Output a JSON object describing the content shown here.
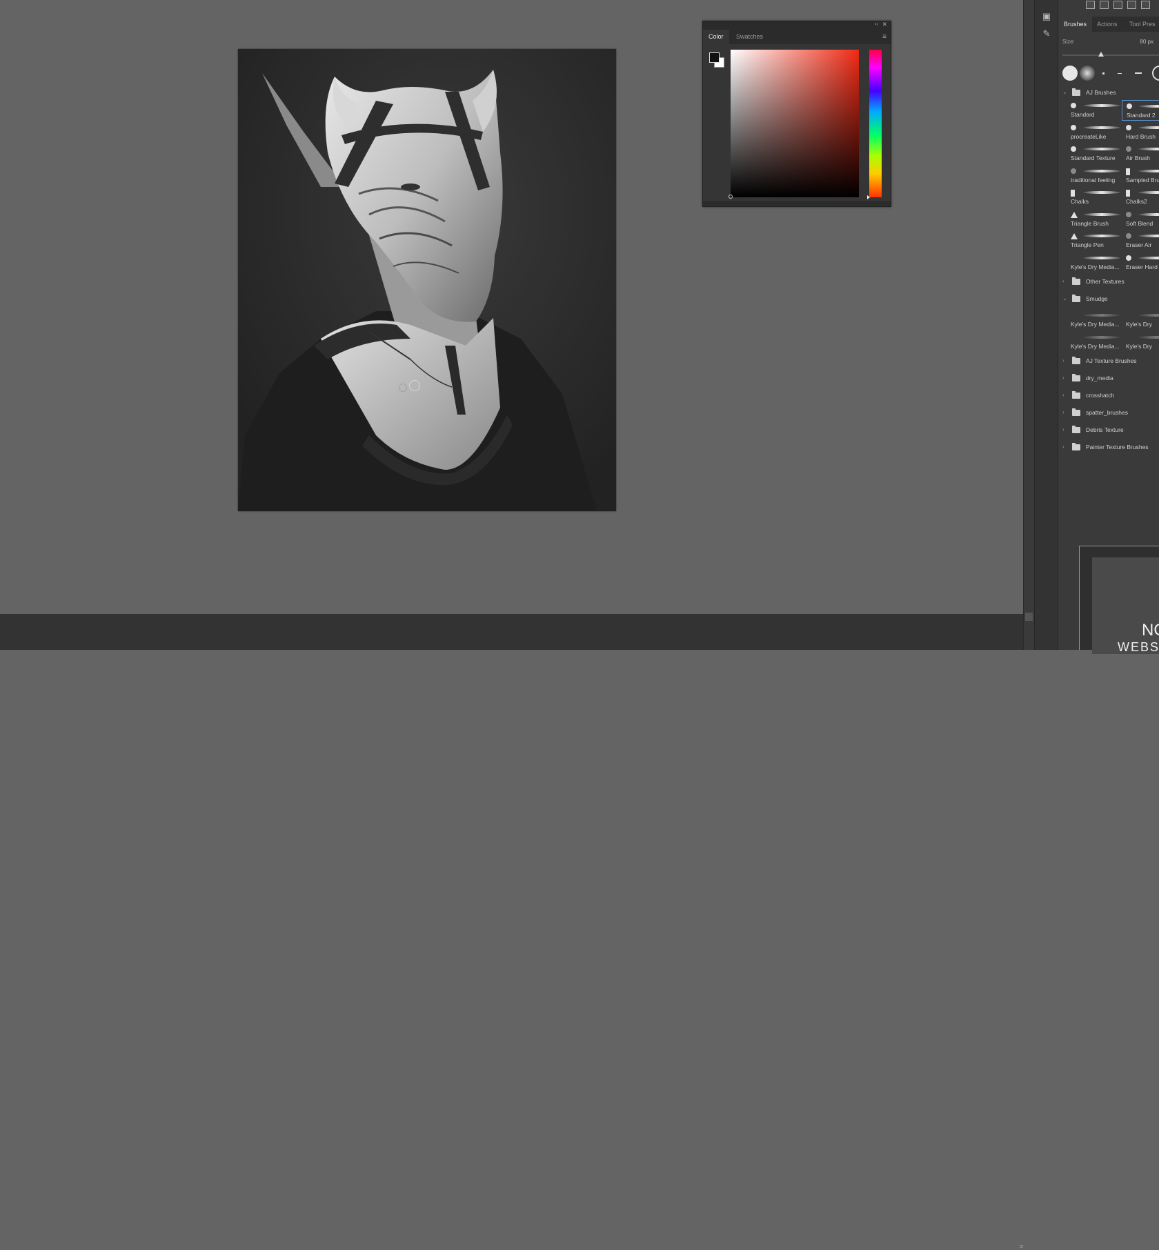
{
  "color_panel": {
    "tabs": [
      "Color",
      "Swatches"
    ],
    "active_tab": "Color",
    "foreground_color": "#111111",
    "background_color": "#ffffff",
    "hue_color": "#f02a14",
    "collapse_icon": "double-chevron-left-icon",
    "close_icon": "close-icon",
    "menu_icon": "hamburger-menu-icon"
  },
  "brushes_panel": {
    "tabs": [
      "Brushes",
      "Actions",
      "Tool Pres"
    ],
    "active_tab": "Brushes",
    "size_label": "Size:",
    "size_value": "80 px",
    "size_fraction": 0.4,
    "groups": [
      {
        "name": "AJ Brushes",
        "expanded": true,
        "brushes": [
          {
            "label": "Standard",
            "tip": "round"
          },
          {
            "label": "Standard 2",
            "tip": "round",
            "selected": true
          },
          {
            "label": "procreateLike",
            "tip": "round"
          },
          {
            "label": "Hard Brush",
            "tip": "round"
          },
          {
            "label": "Standard Texture",
            "tip": "round"
          },
          {
            "label": "Air Brush",
            "tip": "round-dim"
          },
          {
            "label": "traditional feeling",
            "tip": "round-dim"
          },
          {
            "label": "Sampled Brush",
            "tip": "rect"
          },
          {
            "label": "Chalks",
            "tip": "rect"
          },
          {
            "label": "Chalks2",
            "tip": "rect"
          },
          {
            "label": "Triangle Brush",
            "tip": "triangle"
          },
          {
            "label": "Soft Blend",
            "tip": "round-dim"
          },
          {
            "label": "Triangle Pen",
            "tip": "triangle"
          },
          {
            "label": "Eraser Air",
            "tip": "round-dim"
          },
          {
            "label": "Kyle's Dry Media...",
            "tip": "none"
          },
          {
            "label": "Eraser Hard",
            "tip": "round"
          }
        ]
      },
      {
        "name": "Other Textures",
        "expanded": false
      },
      {
        "name": "Smudge",
        "expanded": true,
        "brushes": [
          {
            "label": "Kyle's Dry Media...",
            "tip": "none"
          },
          {
            "label": "Kyle's Dry",
            "tip": "none"
          },
          {
            "label": "Kyle's Dry Media...",
            "tip": "none"
          },
          {
            "label": "Kyle's Dry",
            "tip": "none"
          }
        ]
      },
      {
        "name": "AJ Texture Brushes",
        "expanded": false
      },
      {
        "name": "dry_media",
        "expanded": false
      },
      {
        "name": "crosshatch",
        "expanded": false
      },
      {
        "name": "spatter_brushes",
        "expanded": false
      },
      {
        "name": "Debris Texture",
        "expanded": false
      },
      {
        "name": "Painter Texture Brushes",
        "expanded": false
      }
    ]
  },
  "preview": {
    "line1": "NO",
    "line2": "WEBS"
  },
  "canvas": {
    "subject": "grayscale sci-fi creature portrait"
  }
}
